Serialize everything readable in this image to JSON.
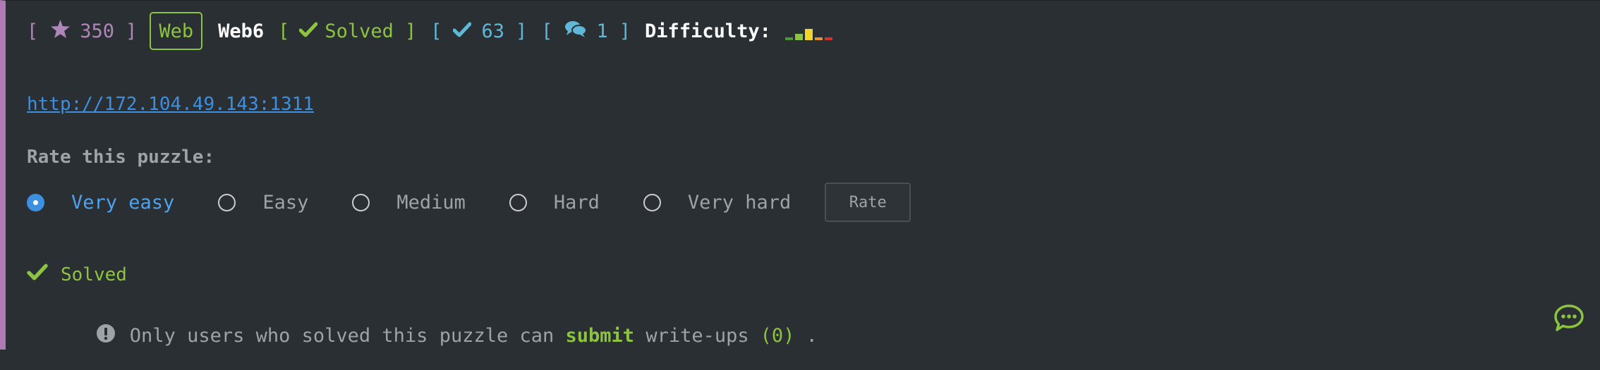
{
  "header": {
    "bracket_open": "[",
    "bracket_close": "]",
    "points": "350",
    "category": "Web",
    "puzzle_name": "Web6",
    "status_label": "Solved",
    "solves_count": "63",
    "comments_count": "1",
    "difficulty_label": "Difficulty:"
  },
  "difficulty_bars": [
    {
      "color": "#4a9a2a",
      "level": 0.18
    },
    {
      "color": "#8dc43f",
      "level": 0.45
    },
    {
      "color": "#f2d52b",
      "level": 0.78
    },
    {
      "color": "#e8922b",
      "level": 0.18
    },
    {
      "color": "#d9302c",
      "level": 0.18
    }
  ],
  "link": "http://172.104.49.143:1311",
  "rating": {
    "title": "Rate this puzzle:",
    "options": [
      "Very easy",
      "Easy",
      "Medium",
      "Hard",
      "Very hard"
    ],
    "selected": "Very easy",
    "button_label": "Rate"
  },
  "status": {
    "solved_label": "Solved"
  },
  "writeups": {
    "text_before": " Only users who solved this puzzle can ",
    "link_text": "submit",
    "text_after": " write-ups",
    "count": "(0)",
    "end": " ."
  },
  "colors": {
    "accent_green": "#8dc43f",
    "accent_blue": "#3d8fe0",
    "accent_purple": "#b086b8",
    "accent_cyan": "#5fb8d8",
    "background": "#2a2f34"
  },
  "icons": [
    "star-icon",
    "check-icon",
    "comments-icon",
    "exclamation-circle-icon",
    "chat-bubble-icon"
  ]
}
